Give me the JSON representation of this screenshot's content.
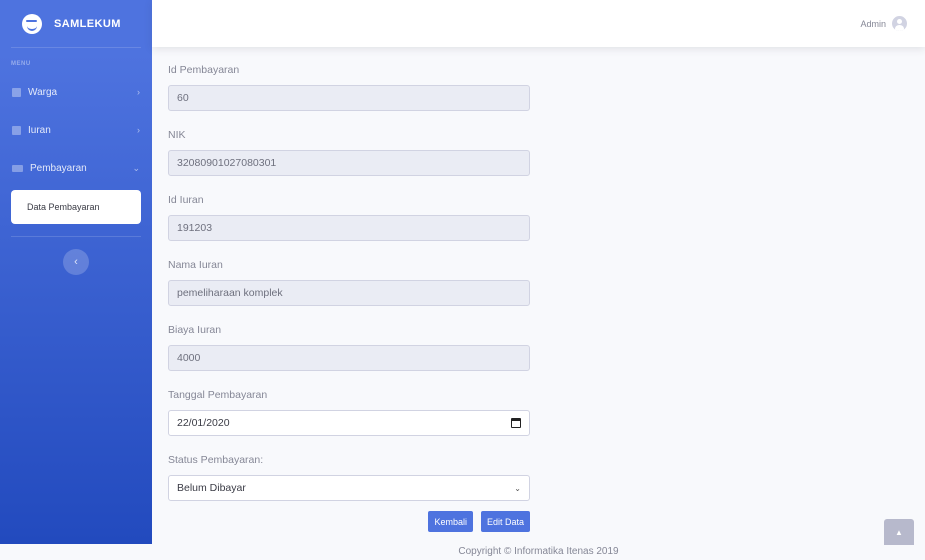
{
  "brand": {
    "name": "SAMLEKUM"
  },
  "sidebar": {
    "heading": "MENU",
    "items": [
      {
        "label": "Warga",
        "chevron": "›"
      },
      {
        "label": "Iuran",
        "chevron": "›"
      },
      {
        "label": "Pembayaran",
        "chevron": "⌄"
      }
    ],
    "sub_item": "Data Pembayaran",
    "toggle": "‹"
  },
  "topbar": {
    "user": "Admin"
  },
  "form": {
    "id_pembayaran": {
      "label": "Id Pembayaran",
      "value": "60"
    },
    "nik": {
      "label": "NIK",
      "value": "32080901027080301"
    },
    "id_iuran": {
      "label": "Id Iuran",
      "value": "191203"
    },
    "nama_iuran": {
      "label": "Nama Iuran",
      "value": "pemeliharaan komplek"
    },
    "biaya_iuran": {
      "label": "Biaya Iuran",
      "value": "4000"
    },
    "tanggal": {
      "label": "Tanggal Pembayaran",
      "value": "22/01/2020"
    },
    "status": {
      "label": "Status Pembayaran:",
      "value": "Belum Dibayar"
    }
  },
  "buttons": {
    "back": "Kembali",
    "edit": "Edit Data"
  },
  "footer": {
    "copyright": "Copyright © Informatika Itenas 2019"
  },
  "scroll_top": {
    "icon": "▲"
  },
  "colors": {
    "primary": "#4e73df",
    "sidebar_end": "#224abe",
    "page_bg": "#f8f9fc",
    "readonly_bg": "#eaecf4"
  }
}
